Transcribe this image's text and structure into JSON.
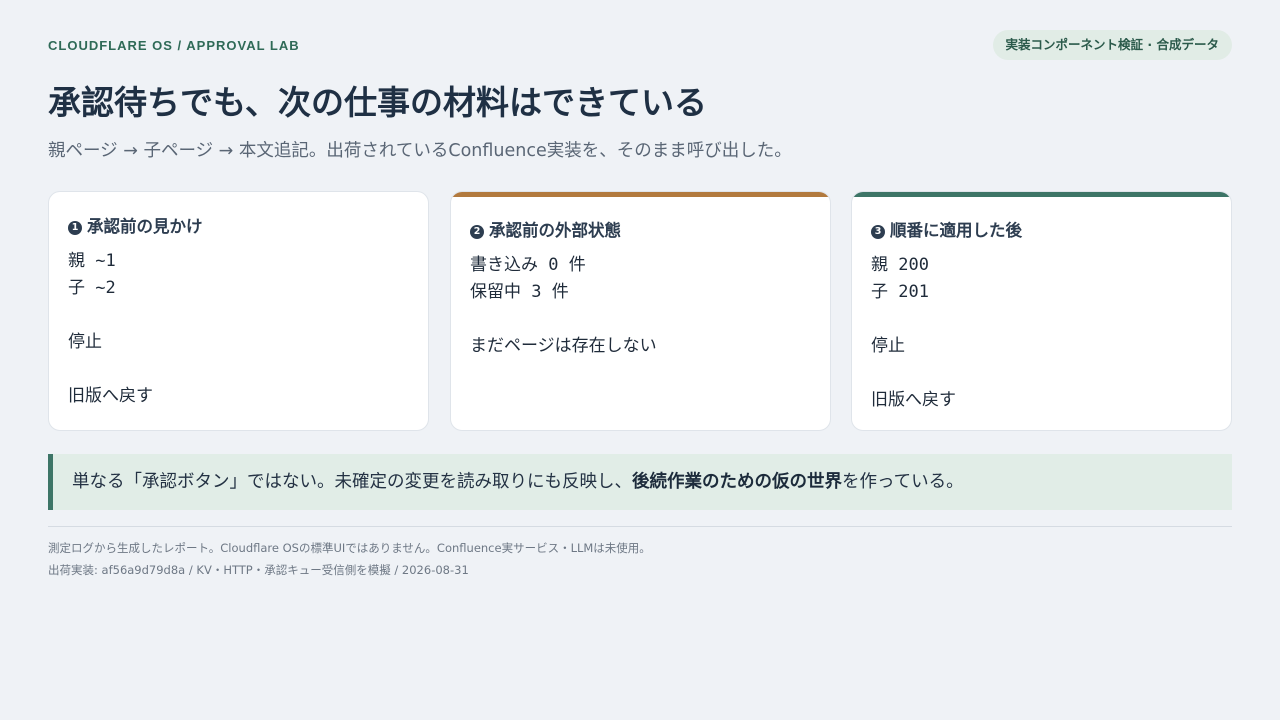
{
  "header": {
    "eyebrow": "CLOUDFLARE OS / APPROVAL LAB",
    "badge": "実装コンポーネント検証 · 合成データ",
    "title": "承認待ちでも、次の仕事の材料はできている",
    "subtitle": "親ページ → 子ページ → 本文追記。出荷されているConfluence実装を、そのまま呼び出した。"
  },
  "cards": [
    {
      "number": "1",
      "title": "承認前の見かけ",
      "lines": [
        "親 ~1",
        "子 ~2",
        "",
        "停止",
        "",
        "旧版へ戻す"
      ],
      "accent": ""
    },
    {
      "number": "2",
      "title": "承認前の外部状態",
      "lines": [
        "書き込み 0 件",
        "保留中 3 件",
        "",
        "まだページは存在しない"
      ],
      "accent": "#b27a3e"
    },
    {
      "number": "3",
      "title": "順番に適用した後",
      "lines": [
        "親 200",
        "子 201",
        "",
        "停止",
        "",
        "旧版へ戻す"
      ],
      "accent": "#3d7567"
    }
  ],
  "note": {
    "prefix": "単なる「承認ボタン」ではない。未確定の変更を読み取りにも反映し、",
    "emphasis": "後続作業のための仮の世界",
    "suffix": "を作っている。"
  },
  "footer": {
    "line1": "測定ログから生成したレポート。Cloudflare OSの標準UIではありません。Confluence実サービス・LLMは未使用。",
    "line2": "出荷実装: af56a9d79d8a / KV・HTTP・承認キュー受信側を模擬 / 2026-08-31"
  },
  "colors": {
    "background": "#eff2f6",
    "brand_green": "#2f6a57",
    "accent_orange": "#b27a3e",
    "accent_teal": "#3d7567"
  }
}
